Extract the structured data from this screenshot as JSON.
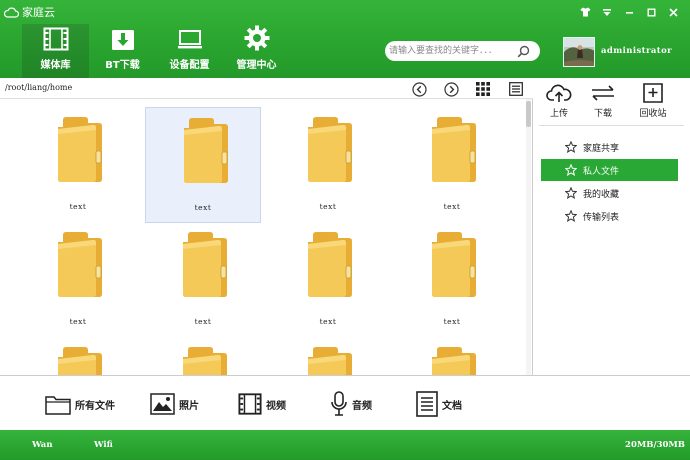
{
  "app": {
    "title": "家庭云"
  },
  "window_controls": [
    {
      "name": "skin-button",
      "icon": "shirt-icon"
    },
    {
      "name": "menu-button",
      "icon": "dropdown-icon"
    },
    {
      "name": "minimize-button",
      "icon": "minimize-icon"
    },
    {
      "name": "maximize-button",
      "icon": "maximize-icon"
    },
    {
      "name": "close-button",
      "icon": "close-icon"
    }
  ],
  "nav_tabs": [
    {
      "label": "媒体库",
      "icon": "film-icon",
      "active": true
    },
    {
      "label": "BT下载",
      "icon": "download-box-icon",
      "active": false
    },
    {
      "label": "设备配置",
      "icon": "monitor-icon",
      "active": false
    },
    {
      "label": "管理中心",
      "icon": "gear-icon",
      "active": false
    }
  ],
  "search": {
    "placeholder": "请输入要查找的关键字．．．",
    "icon": "search-icon"
  },
  "user": {
    "name": "administrator",
    "avatar": "avatar-photo"
  },
  "path_bar": {
    "path": "/root/liang/home",
    "buttons": [
      "back-circle-icon",
      "forward-circle-icon",
      "grid-view-icon",
      "list-view-icon"
    ]
  },
  "files": [
    {
      "label": "text",
      "icon": "folder-icon",
      "selected": false
    },
    {
      "label": "text",
      "icon": "folder-icon",
      "selected": true
    },
    {
      "label": "text",
      "icon": "folder-icon",
      "selected": false
    },
    {
      "label": "text",
      "icon": "folder-icon",
      "selected": false
    },
    {
      "label": "text",
      "icon": "folder-icon",
      "selected": false
    },
    {
      "label": "text",
      "icon": "folder-icon",
      "selected": false
    },
    {
      "label": "text",
      "icon": "folder-icon",
      "selected": false
    },
    {
      "label": "text",
      "icon": "folder-icon",
      "selected": false
    },
    {
      "label": "",
      "icon": "folder-icon",
      "selected": false
    },
    {
      "label": "",
      "icon": "folder-icon",
      "selected": false
    },
    {
      "label": "",
      "icon": "folder-icon",
      "selected": false
    },
    {
      "label": "",
      "icon": "folder-icon",
      "selected": false
    }
  ],
  "right_panel": {
    "actions": [
      {
        "label": "上传",
        "icon": "upload-cloud-icon"
      },
      {
        "label": "下载",
        "icon": "swap-arrows-icon"
      },
      {
        "label": "回收站",
        "icon": "recycle-bin-icon"
      }
    ],
    "list": [
      {
        "label": "家庭共享",
        "icon": "star-icon",
        "active": false
      },
      {
        "label": "私人文件",
        "icon": "star-icon",
        "active": true
      },
      {
        "label": "我的收藏",
        "icon": "star-icon",
        "active": false
      },
      {
        "label": "传输列表",
        "icon": "star-icon",
        "active": false
      }
    ]
  },
  "categories": [
    {
      "label": "所有文件",
      "icon": "folder-outline-icon"
    },
    {
      "label": "照片",
      "icon": "photo-icon"
    },
    {
      "label": "视频",
      "icon": "film-icon"
    },
    {
      "label": "音频",
      "icon": "microphone-icon"
    },
    {
      "label": "文档",
      "icon": "document-icon"
    }
  ],
  "status": {
    "wan": "Wan",
    "wifi": "Wifi",
    "storage": "20MB/30MB"
  },
  "colors": {
    "brand_green": "#2aa52f",
    "selection_bg": "#eaf0fb",
    "folder_yellow": "#f3c64f"
  }
}
